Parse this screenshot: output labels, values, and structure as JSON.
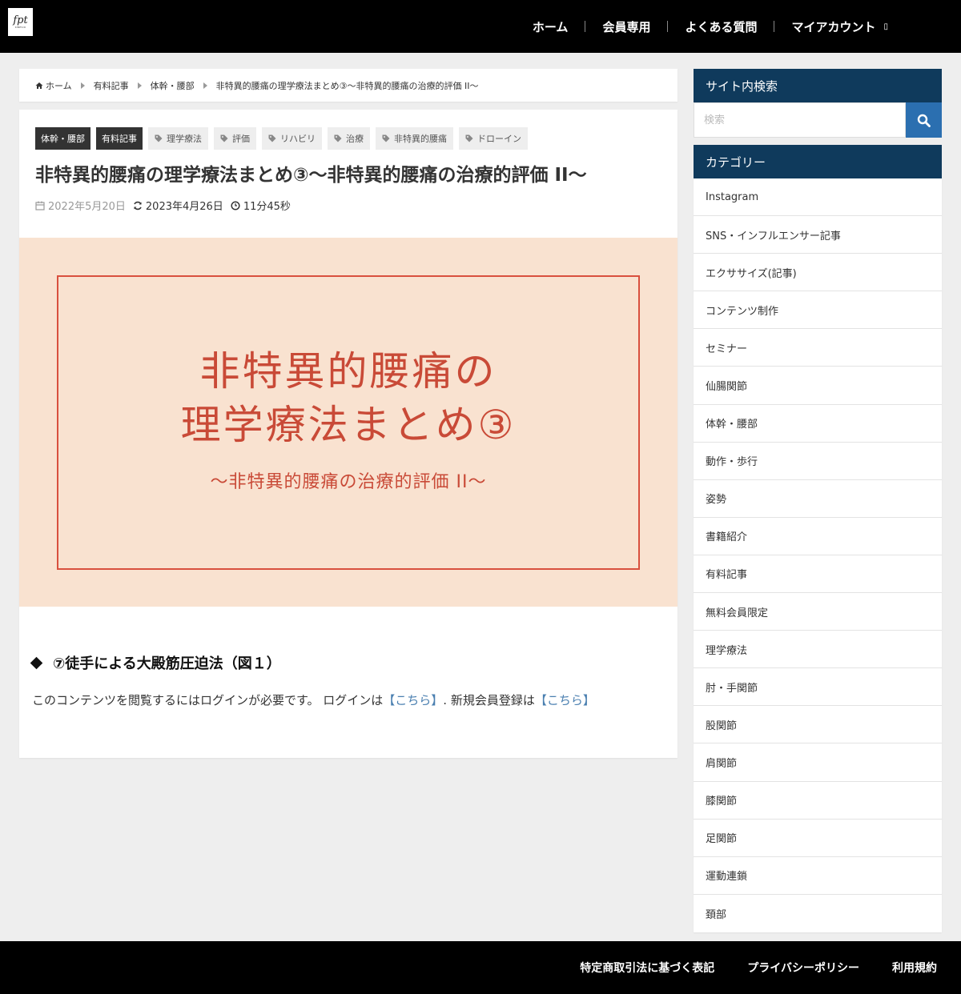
{
  "header": {
    "logo_text": "fpt",
    "logo_sub": "KINESIO",
    "nav": [
      {
        "label": "ホーム"
      },
      {
        "label": "会員専用"
      },
      {
        "label": "よくある質問"
      },
      {
        "label": "マイアカウント"
      }
    ]
  },
  "breadcrumb": [
    "ホーム",
    "有料記事",
    "体幹・腰部",
    "非特異的腰痛の理学療法まとめ③〜非特異的腰痛の治療的評価 II〜"
  ],
  "article": {
    "categories": [
      "体幹・腰部",
      "有料記事"
    ],
    "tags": [
      "理学療法",
      "評価",
      "リハビリ",
      "治療",
      "非特異的腰痛",
      "ドローイン"
    ],
    "title": "非特異的腰痛の理学療法まとめ③〜非特異的腰痛の治療的評価 II〜",
    "published": "2022年5月20日",
    "updated": "2023年4月26日",
    "read_time": "11分45秒",
    "eyecatch": {
      "line1": "非特異的腰痛の",
      "line2": "理学療法まとめ③",
      "sub": "〜非特異的腰痛の治療的評価 II〜"
    },
    "section_heading": "⑦徒手による大殿筋圧迫法（図１）",
    "login_text_1": "このコンテンツを閲覧するにはログインが必要です。 ログインは",
    "login_link": "【こちら】",
    "login_text_2": ". 新規会員登録は",
    "register_link": "【こちら】"
  },
  "sidebar": {
    "search_heading": "サイト内検索",
    "search_placeholder": "検索",
    "category_heading": "カテゴリー",
    "categories": [
      "Instagram",
      "SNS・インフルエンサー記事",
      "エクササイズ(記事)",
      "コンテンツ制作",
      "セミナー",
      "仙腸関節",
      "体幹・腰部",
      "動作・歩行",
      "姿勢",
      "書籍紹介",
      "有料記事",
      "無料会員限定",
      "理学療法",
      "肘・手関節",
      "股関節",
      "肩関節",
      "膝関節",
      "足関節",
      "運動連鎖",
      "頚部"
    ]
  },
  "footer": {
    "links": [
      "特定商取引法に基づく表記",
      "プライバシーポリシー",
      "利用規約"
    ]
  },
  "colors": {
    "header_bg": "#000000",
    "sidebar_heading_bg": "#0f3a5c",
    "search_button": "#2b6fb0",
    "eyecatch_bg": "#f9e2d0",
    "eyecatch_text": "#c94a37",
    "link": "#4a7fb0"
  }
}
